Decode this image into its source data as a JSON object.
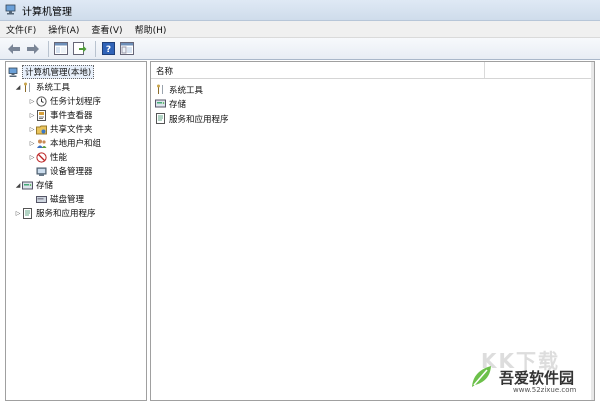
{
  "window": {
    "title": "计算机管理"
  },
  "menubar": {
    "items": [
      {
        "label": "文件(F)"
      },
      {
        "label": "操作(A)"
      },
      {
        "label": "查看(V)"
      },
      {
        "label": "帮助(H)"
      }
    ]
  },
  "toolbar": {
    "buttons": [
      "back-arrow-icon",
      "forward-arrow-icon",
      "show-tree-icon",
      "export-list-icon",
      "help-icon",
      "properties-icon"
    ]
  },
  "tree": {
    "root": {
      "label": "计算机管理(本地)",
      "icon": "computer-manage-icon"
    },
    "system_tools": {
      "label": "系统工具",
      "icon": "tools-icon",
      "children": [
        {
          "label": "任务计划程序",
          "icon": "clock-icon"
        },
        {
          "label": "事件查看器",
          "icon": "event-viewer-icon"
        },
        {
          "label": "共享文件夹",
          "icon": "shared-folder-icon"
        },
        {
          "label": "本地用户和组",
          "icon": "users-icon"
        },
        {
          "label": "性能",
          "icon": "performance-icon"
        },
        {
          "label": "设备管理器",
          "icon": "device-manager-icon"
        }
      ]
    },
    "storage": {
      "label": "存储",
      "icon": "storage-icon",
      "children": [
        {
          "label": "磁盘管理",
          "icon": "disk-icon"
        }
      ]
    },
    "services": {
      "label": "服务和应用程序",
      "icon": "services-icon"
    }
  },
  "list": {
    "column_name": "名称",
    "items": [
      {
        "label": "系统工具",
        "icon": "tools-icon"
      },
      {
        "label": "存储",
        "icon": "storage-icon"
      },
      {
        "label": "服务和应用程序",
        "icon": "services-icon"
      }
    ]
  },
  "watermark": {
    "ghost": "KK下载",
    "name": "吾爱软件园",
    "url": "www.52zixue.com"
  }
}
